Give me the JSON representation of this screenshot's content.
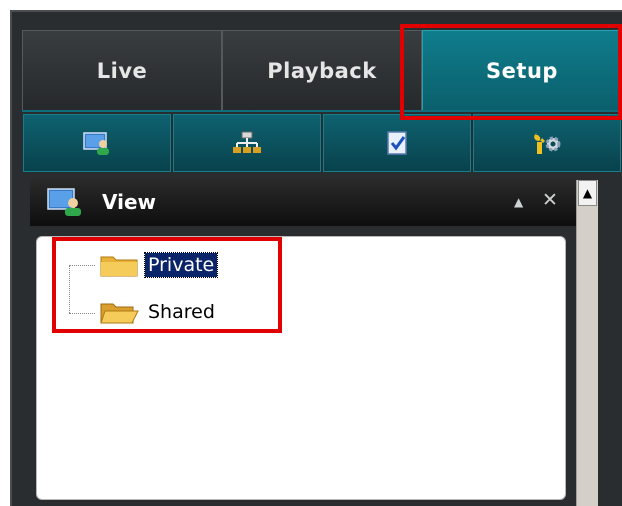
{
  "tabs": [
    {
      "label": "Live",
      "active": false
    },
    {
      "label": "Playback",
      "active": false
    },
    {
      "label": "Setup",
      "active": true
    }
  ],
  "toolbar": {
    "icons": [
      "monitor-user-icon",
      "network-hierarchy-icon",
      "checklist-document-icon",
      "wrench-gear-icon"
    ]
  },
  "panel": {
    "title": "View",
    "collapse_glyph": "▲",
    "close_glyph": "✕"
  },
  "tree": {
    "items": [
      {
        "label": "Private",
        "selected": true,
        "icon": "folder-closed-icon"
      },
      {
        "label": "Shared",
        "selected": false,
        "icon": "folder-open-icon"
      }
    ]
  },
  "scrollbar": {
    "up_glyph": "▲"
  },
  "colors": {
    "active_tab": "#0b6c7a",
    "highlight": "#e00000",
    "selection": "#0a246a"
  }
}
